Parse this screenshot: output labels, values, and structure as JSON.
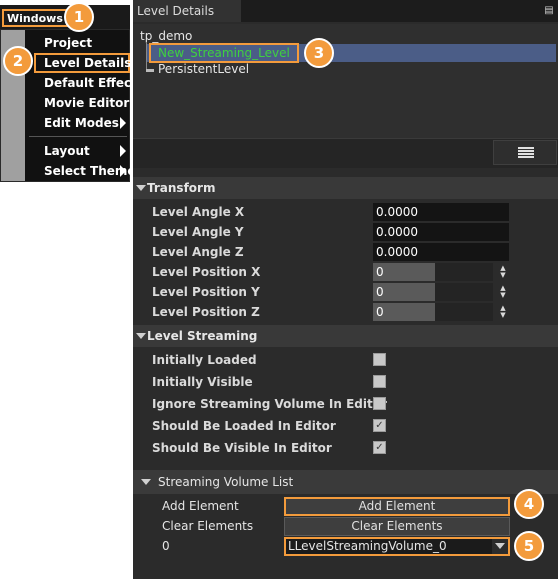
{
  "menu": {
    "title": "Windows",
    "items": [
      {
        "label": "Project",
        "submenu": false
      },
      {
        "label": "Level Details",
        "submenu": false,
        "highlighted": true
      },
      {
        "label": "Default Effect",
        "submenu": false
      },
      {
        "label": "Movie Editor",
        "submenu": false
      },
      {
        "label": "Edit Modes",
        "submenu": true
      },
      {
        "label": "Layout",
        "submenu": true
      },
      {
        "label": "Select Theme",
        "submenu": true
      }
    ]
  },
  "badges": [
    "1",
    "2",
    "3",
    "4",
    "5"
  ],
  "panel": {
    "tab_label": "Level Details",
    "pin_icon": "pin-icon",
    "tree": {
      "root": "tp_demo",
      "streaming_level": "New_Streaming_Level",
      "persistent_level": "PersistentLevel"
    },
    "filter_icon": "filter-lines-icon"
  },
  "transform": {
    "header": "Transform",
    "angle_x_label": "Level Angle X",
    "angle_x_value": "0.0000",
    "angle_y_label": "Level Angle Y",
    "angle_y_value": "0.0000",
    "angle_z_label": "Level Angle Z",
    "angle_z_value": "0.0000",
    "pos_x_label": "Level Position X",
    "pos_x_value": "0",
    "pos_y_label": "Level Position Y",
    "pos_y_value": "0",
    "pos_z_label": "Level Position Z",
    "pos_z_value": "0"
  },
  "streaming": {
    "header": "Level Streaming",
    "initially_loaded_label": "Initially Loaded",
    "initially_loaded": false,
    "initially_visible_label": "Initially Visible",
    "initially_visible": false,
    "ignore_volume_label": "Ignore Streaming Volume In Editor",
    "ignore_volume": false,
    "loaded_in_editor_label": "Should Be Loaded In Editor",
    "loaded_in_editor": true,
    "visible_in_editor_label": "Should Be Visible In Editor",
    "visible_in_editor": true,
    "check_mark": "✓"
  },
  "volume_list": {
    "header": "Streaming Volume List",
    "add_label": "Add Element",
    "add_button": "Add Element",
    "clear_label": "Clear Elements",
    "clear_button": "Clear Elements",
    "index_label": "0",
    "selected_volume": "LLevelStreamingVolume_0"
  },
  "colors": {
    "accent": "#f39b3c",
    "selection": "#4b5d87",
    "streaming_level_text": "#3fd13f"
  }
}
